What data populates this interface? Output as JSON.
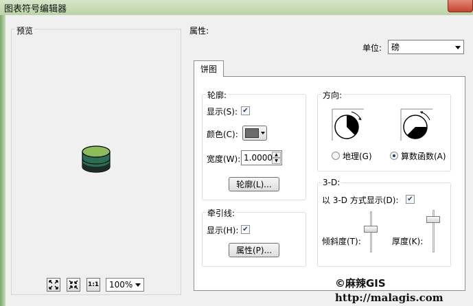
{
  "window": {
    "title": "图表符号编辑器"
  },
  "preview": {
    "label": "预览",
    "zoom": "100%",
    "cylinder_top_color": "#8dbb5a",
    "cylinder_side_color": "#2b6d55"
  },
  "properties": {
    "label": "属性:",
    "unit_label": "单位:",
    "unit_value": "磅",
    "tab_label": "饼图",
    "outline": {
      "title": "轮廓:",
      "show_label": "显示(S):",
      "color_label": "颜色(C):",
      "width_label": "宽度(W):",
      "width_value": "1.0000",
      "button_label": "轮廓(L)..."
    },
    "leader": {
      "title": "牵引线:",
      "show_label": "显示(H):",
      "button_label": "属性(P)..."
    },
    "orientation": {
      "title": "方向:",
      "geographic_label": "地理(G)",
      "arithmetic_label": "算数函数(A)"
    },
    "threed": {
      "title": "3-D:",
      "show_label": "以 3-D 方式显示(D):",
      "tilt_label": "倾斜度(T):",
      "thickness_label": "厚度(K):"
    }
  },
  "watermark": {
    "line1": "©麻辣GIS",
    "line2": "http://malagis.com"
  }
}
